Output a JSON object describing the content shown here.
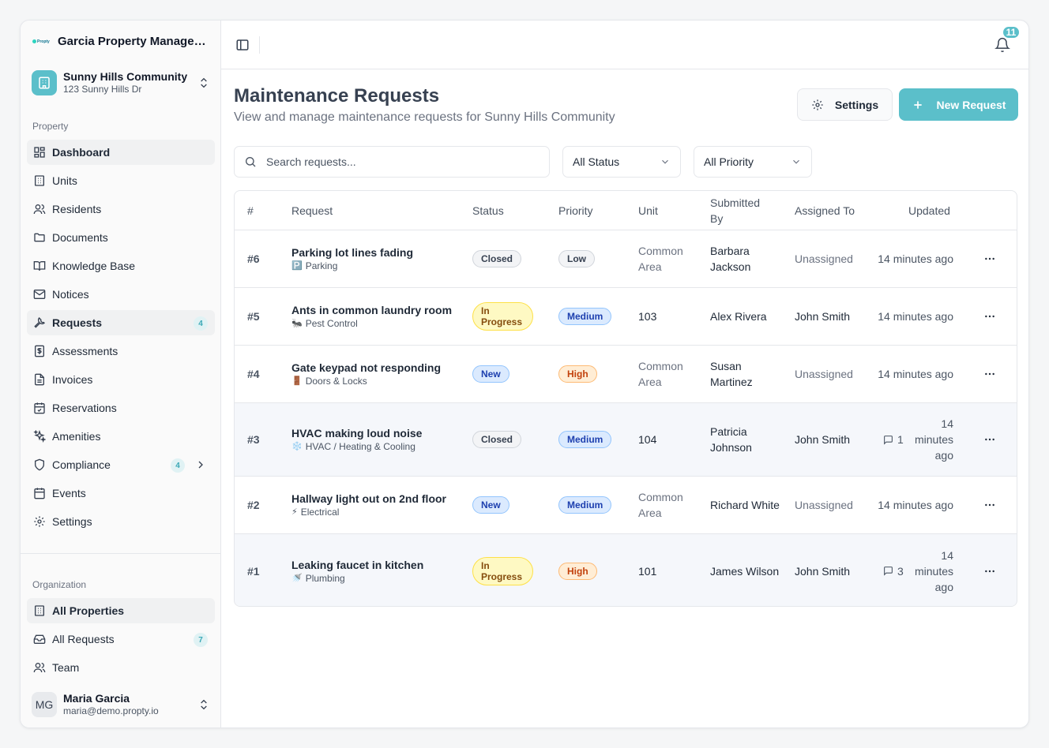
{
  "brand": {
    "name": "Garcia Property Management",
    "logo_text": "Propty"
  },
  "property": {
    "name": "Sunny Hills Community",
    "address": "123 Sunny Hills Dr"
  },
  "sidebar": {
    "property_label": "Property",
    "items": [
      {
        "label": "Dashboard",
        "icon": "dashboard-icon",
        "active": true
      },
      {
        "label": "Units",
        "icon": "building-icon"
      },
      {
        "label": "Residents",
        "icon": "users-icon"
      },
      {
        "label": "Documents",
        "icon": "folder-icon"
      },
      {
        "label": "Knowledge Base",
        "icon": "book-icon"
      },
      {
        "label": "Notices",
        "icon": "mail-icon"
      },
      {
        "label": "Requests",
        "icon": "wrench-icon",
        "badge": "4",
        "active": true
      },
      {
        "label": "Assessments",
        "icon": "dollar-icon"
      },
      {
        "label": "Invoices",
        "icon": "file-icon"
      },
      {
        "label": "Reservations",
        "icon": "calendar-check-icon"
      },
      {
        "label": "Amenities",
        "icon": "sparkles-icon"
      },
      {
        "label": "Compliance",
        "icon": "shield-icon",
        "badge": "4"
      },
      {
        "label": "Events",
        "icon": "calendar-icon"
      },
      {
        "label": "Settings",
        "icon": "gear-icon"
      }
    ],
    "org_label": "Organization",
    "org_items": [
      {
        "label": "All Properties",
        "icon": "building-icon",
        "active": true
      },
      {
        "label": "All Requests",
        "icon": "inbox-icon",
        "badge": "7"
      },
      {
        "label": "Team",
        "icon": "users-icon"
      }
    ]
  },
  "user": {
    "initials": "MG",
    "name": "Maria Garcia",
    "email": "maria@demo.propty.io"
  },
  "topbar": {
    "notifications": "11"
  },
  "page": {
    "title": "Maintenance Requests",
    "subtitle": "View and manage maintenance requests for Sunny Hills Community",
    "settings_label": "Settings",
    "new_label": "New Request"
  },
  "filters": {
    "search_placeholder": "Search requests...",
    "status": "All Status",
    "priority": "All Priority"
  },
  "table": {
    "columns": [
      "#",
      "Request",
      "Status",
      "Priority",
      "Unit",
      "Submitted By",
      "Assigned To",
      "Updated"
    ],
    "rows": [
      {
        "num": "#6",
        "title": "Parking lot lines fading",
        "cat_icon": "🅿️",
        "category": "Parking",
        "status": "Closed",
        "priority": "Low",
        "unit": "Common Area",
        "submitted": "Barbara Jackson",
        "assigned": "Unassigned",
        "comments": "",
        "updated": "14 minutes ago"
      },
      {
        "num": "#5",
        "title": "Ants in common laundry room",
        "cat_icon": "🐜",
        "category": "Pest Control",
        "status": "In Progress",
        "priority": "Medium",
        "unit": "103",
        "submitted": "Alex Rivera",
        "assigned": "John Smith",
        "comments": "",
        "updated": "14 minutes ago"
      },
      {
        "num": "#4",
        "title": "Gate keypad not responding",
        "cat_icon": "🚪",
        "category": "Doors & Locks",
        "status": "New",
        "priority": "High",
        "unit": "Common Area",
        "submitted": "Susan Martinez",
        "assigned": "Unassigned",
        "comments": "",
        "updated": "14 minutes ago"
      },
      {
        "num": "#3",
        "title": "HVAC making loud noise",
        "cat_icon": "❄️",
        "category": "HVAC / Heating & Cooling",
        "status": "Closed",
        "priority": "Medium",
        "unit": "104",
        "submitted": "Patricia Johnson",
        "assigned": "John Smith",
        "comments": "1",
        "updated": "14 minutes ago"
      },
      {
        "num": "#2",
        "title": "Hallway light out on 2nd floor",
        "cat_icon": "⚡",
        "category": "Electrical",
        "status": "New",
        "priority": "Medium",
        "unit": "Common Area",
        "submitted": "Richard White",
        "assigned": "Unassigned",
        "comments": "",
        "updated": "14 minutes ago"
      },
      {
        "num": "#1",
        "title": "Leaking faucet in kitchen",
        "cat_icon": "🚿",
        "category": "Plumbing",
        "status": "In Progress",
        "priority": "High",
        "unit": "101",
        "submitted": "James Wilson",
        "assigned": "John Smith",
        "comments": "3",
        "updated": "14 minutes ago"
      }
    ]
  },
  "colors": {
    "accent": "#5bbfca"
  }
}
